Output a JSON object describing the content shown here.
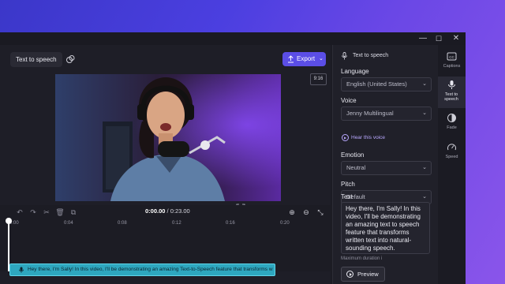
{
  "window_controls": {
    "minimize": "—",
    "maximize": "☐",
    "close": "✕"
  },
  "editor": {
    "tab_label": "Text to speech",
    "export_label": "Export",
    "aspect_ratio": "9:16",
    "timecode_current": "0:00.00",
    "timecode_sep": " / ",
    "timecode_total": "0:23.00",
    "ruler_ticks": [
      "0:00",
      "0:04",
      "0:08",
      "0:12",
      "0:16",
      "0:20"
    ],
    "clip_text": "Hey there, I'm Sally! In this video, I'll be demonstrating an amazing Text-to-Speech feature that transforms w"
  },
  "panel": {
    "title": "Text to speech",
    "language_label": "Language",
    "language_value": "English (United States)",
    "voice_label": "Voice",
    "voice_value": "Jenny Multilingual",
    "hear_voice": "Hear this voice",
    "emotion_label": "Emotion",
    "emotion_value": "Neutral",
    "pitch_label": "Pitch",
    "pitch_value": "Default",
    "text_label": "Text",
    "text_value": "Hey there, I'm Sally! In this video, I'll be demonstrating an amazing text to speech feature that transforms written text into natural-sounding speech.",
    "max_duration": "Maximum duration i",
    "preview_label": "Preview"
  },
  "rail": [
    {
      "label": "Captions",
      "icon": "captions-icon"
    },
    {
      "label": "Text to speech",
      "icon": "microphone-icon"
    },
    {
      "label": "Fade",
      "icon": "fade-icon"
    },
    {
      "label": "Speed",
      "icon": "speedometer-icon"
    }
  ],
  "colors": {
    "accent": "#5b4ee6",
    "clip": "#2ea7bf",
    "link": "#b9a8ff"
  }
}
